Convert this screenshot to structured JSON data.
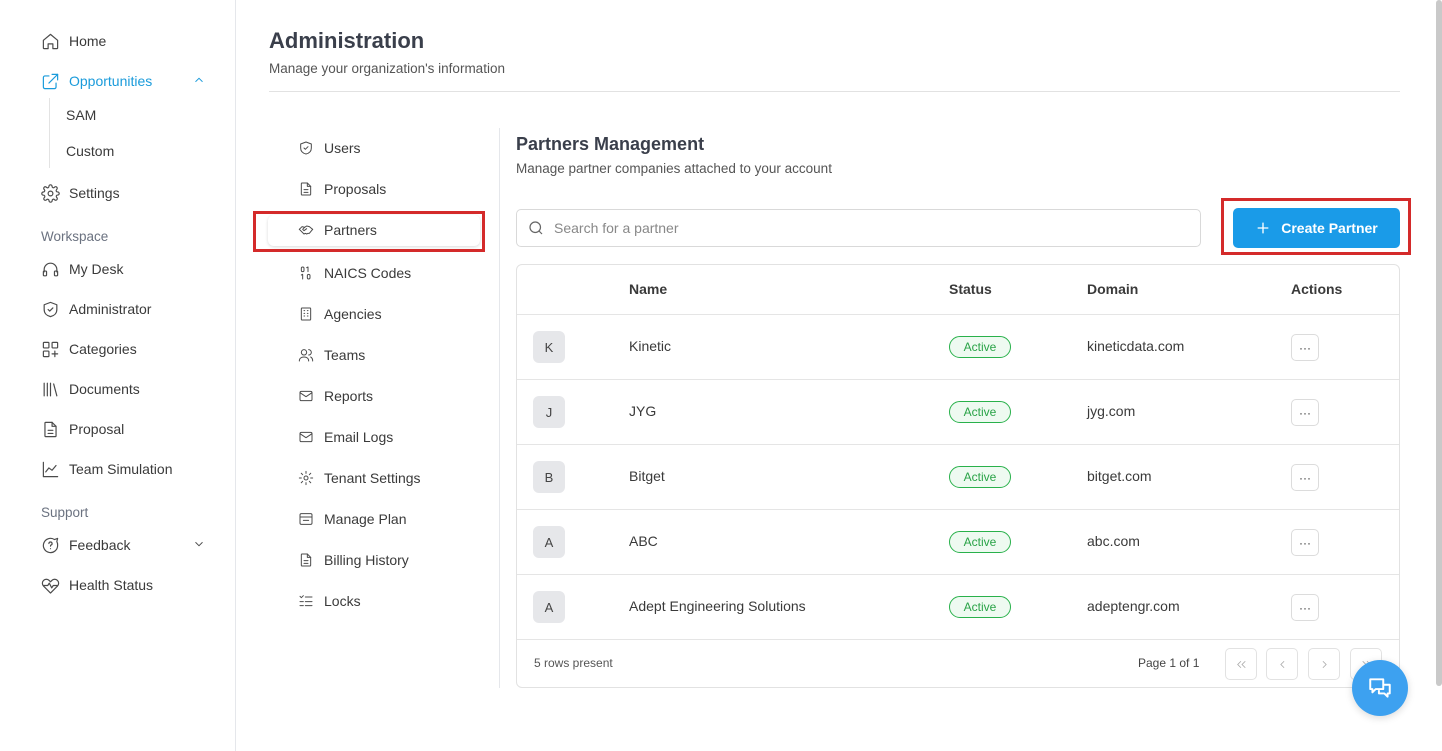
{
  "sidebar": {
    "items": [
      {
        "label": "Home",
        "icon": "home-icon"
      },
      {
        "label": "Opportunities",
        "icon": "external-link-icon",
        "active": true,
        "expanded": true
      },
      {
        "label": "Settings",
        "icon": "gear-icon"
      }
    ],
    "sub_items": [
      "SAM",
      "Custom"
    ],
    "workspace_label": "Workspace",
    "workspace_items": [
      {
        "label": "My Desk",
        "icon": "headset-icon"
      },
      {
        "label": "Administrator",
        "icon": "shield-icon"
      },
      {
        "label": "Categories",
        "icon": "categories-icon"
      },
      {
        "label": "Documents",
        "icon": "library-icon"
      },
      {
        "label": "Proposal",
        "icon": "document-icon"
      },
      {
        "label": "Team Simulation",
        "icon": "chart-line-icon"
      }
    ],
    "support_label": "Support",
    "support_items": [
      {
        "label": "Feedback",
        "icon": "feedback-icon"
      },
      {
        "label": "Health Status",
        "icon": "heart-pulse-icon"
      }
    ]
  },
  "header": {
    "title": "Administration",
    "subtitle": "Manage your organization's information"
  },
  "admin_menu": {
    "items": [
      {
        "label": "Users",
        "icon": "shield-check-icon"
      },
      {
        "label": "Proposals",
        "icon": "document-icon"
      },
      {
        "label": "Partners",
        "icon": "handshake-icon",
        "active": true
      },
      {
        "label": "NAICS Codes",
        "icon": "binary-icon"
      },
      {
        "label": "Agencies",
        "icon": "building-icon"
      },
      {
        "label": "Teams",
        "icon": "users-icon"
      },
      {
        "label": "Reports",
        "icon": "mail-icon"
      },
      {
        "label": "Email Logs",
        "icon": "mail-icon"
      },
      {
        "label": "Tenant Settings",
        "icon": "gear-icon"
      },
      {
        "label": "Manage Plan",
        "icon": "inbox-icon"
      },
      {
        "label": "Billing History",
        "icon": "document-icon"
      },
      {
        "label": "Locks",
        "icon": "list-check-icon"
      }
    ]
  },
  "main": {
    "title": "Partners Management",
    "subtitle": "Manage partner companies attached to your account",
    "search_placeholder": "Search for a partner",
    "create_label": "Create Partner",
    "table": {
      "headers": [
        "Name",
        "Status",
        "Domain",
        "Actions"
      ],
      "rows": [
        {
          "initial": "K",
          "name": "Kinetic",
          "status": "Active",
          "domain": "kineticdata.com",
          "action": "···"
        },
        {
          "initial": "J",
          "name": "JYG",
          "status": "Active",
          "domain": "jyg.com",
          "action": "···"
        },
        {
          "initial": "B",
          "name": "Bitget",
          "status": "Active",
          "domain": "bitget.com",
          "action": "···"
        },
        {
          "initial": "A",
          "name": "ABC",
          "status": "Active",
          "domain": "abc.com",
          "action": "···"
        },
        {
          "initial": "A",
          "name": "Adept Engineering Solutions",
          "status": "Active",
          "domain": "adeptengr.com",
          "action": "···"
        }
      ],
      "footer": {
        "rows_present": "5 rows present",
        "page_info": "Page 1 of 1"
      }
    }
  },
  "colors": {
    "accent": "#1a9be8",
    "active_nav": "#1a9bdb",
    "status_green": "#29a347",
    "highlight_red": "#d42a2a"
  }
}
